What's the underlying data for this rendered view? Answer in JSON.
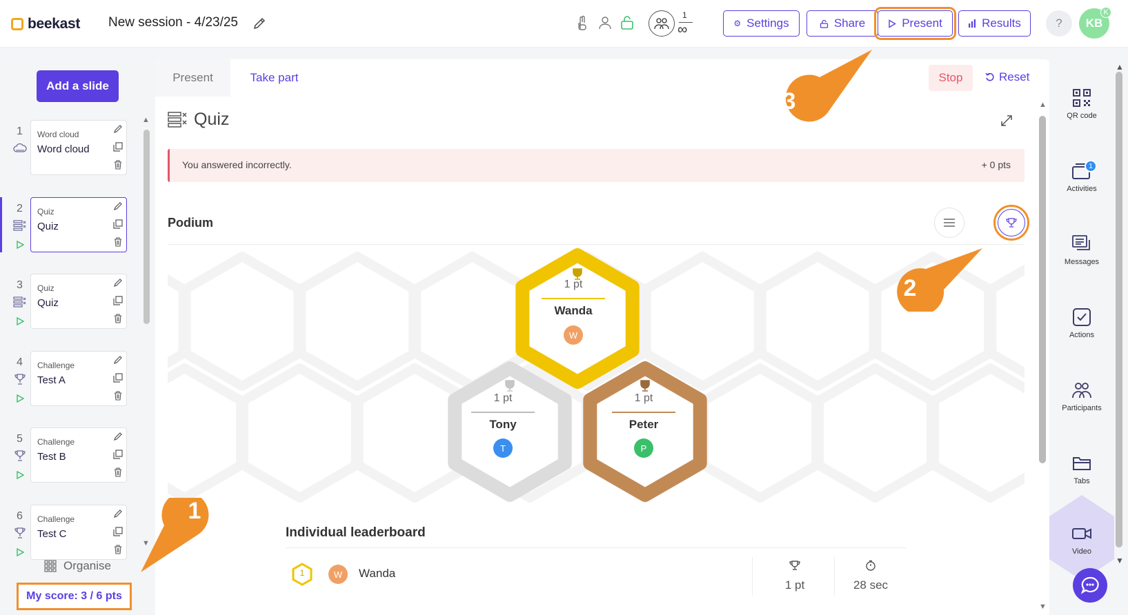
{
  "header": {
    "brand": "beekast",
    "session_title": "New session - 4/23/25",
    "participant_count": "1",
    "participant_limit": "∞",
    "buttons": {
      "settings": "Settings",
      "share": "Share",
      "present": "Present",
      "results": "Results"
    },
    "help_label": "?",
    "avatar_initials": "KB",
    "avatar_badge": "K"
  },
  "sidebar": {
    "add_slide_label": "Add a slide",
    "slides": [
      {
        "num": "1",
        "type": "Word cloud",
        "name": "Word cloud",
        "icon": "cloud-icon",
        "playable": false
      },
      {
        "num": "2",
        "type": "Quiz",
        "name": "Quiz",
        "icon": "quiz-icon",
        "playable": true,
        "active": true
      },
      {
        "num": "3",
        "type": "Quiz",
        "name": "Quiz",
        "icon": "quiz-icon",
        "playable": true
      },
      {
        "num": "4",
        "type": "Challenge",
        "name": "Test A",
        "icon": "trophy-icon",
        "playable": true
      },
      {
        "num": "5",
        "type": "Challenge",
        "name": "Test B",
        "icon": "trophy-icon",
        "playable": true
      },
      {
        "num": "6",
        "type": "Challenge",
        "name": "Test C",
        "icon": "trophy-icon",
        "playable": true
      }
    ],
    "organise_label": "Organise",
    "my_score_label": "My score: 3 / 6 pts"
  },
  "main": {
    "tabs": [
      {
        "label": "Present",
        "active": false
      },
      {
        "label": "Take part",
        "active": true
      }
    ],
    "stop_label": "Stop",
    "reset_label": "Reset",
    "activity_title": "Quiz",
    "feedback": {
      "message": "You answered incorrectly.",
      "points": "+ 0 pts"
    },
    "podium": {
      "title": "Podium",
      "places": [
        {
          "rank": 1,
          "points": "1 pt",
          "name": "Wanda",
          "initial": "W",
          "color": "#f0c400",
          "avatar_color": "#f0a065"
        },
        {
          "rank": 2,
          "points": "1 pt",
          "name": "Tony",
          "initial": "T",
          "color": "#dcdcdc",
          "avatar_color": "#3a8ff0"
        },
        {
          "rank": 3,
          "points": "1 pt",
          "name": "Peter",
          "initial": "P",
          "color": "#c18a55",
          "avatar_color": "#3cbf6a"
        }
      ]
    },
    "leaderboard": {
      "title": "Individual leaderboard",
      "rows": [
        {
          "rank": "1",
          "initial": "W",
          "name": "Wanda",
          "points": "1 pt",
          "time": "28 sec"
        }
      ]
    }
  },
  "rail": {
    "items": [
      {
        "label": "QR code",
        "icon": "qr-code-icon"
      },
      {
        "label": "Activities",
        "icon": "activities-icon",
        "badge": "1"
      },
      {
        "label": "Messages",
        "icon": "messages-icon"
      },
      {
        "label": "Actions",
        "icon": "actions-icon"
      },
      {
        "label": "Participants",
        "icon": "participants-icon"
      },
      {
        "label": "Tabs",
        "icon": "tabs-icon"
      },
      {
        "label": "Video",
        "icon": "video-icon"
      }
    ]
  },
  "annotations": [
    "1",
    "2",
    "3"
  ],
  "colors": {
    "accent": "#5b3fe0",
    "highlight": "#f0902a",
    "error": "#e25767",
    "gold": "#f0c400",
    "silver": "#dcdcdc",
    "bronze": "#c18a55"
  }
}
